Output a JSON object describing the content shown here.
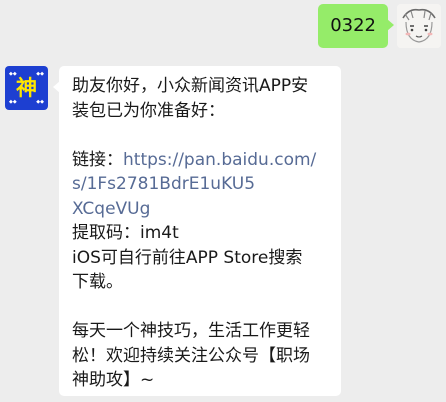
{
  "colors": {
    "background": "#ededed",
    "outgoing_bubble": "#95ec69",
    "incoming_bubble": "#ffffff",
    "link": "#576b95",
    "bot_avatar_bg": "#1d3fd1",
    "bot_avatar_text": "#ffe600"
  },
  "outgoing": {
    "text": "0322",
    "avatar_icon": "user-avatar-icon"
  },
  "incoming": {
    "avatar": {
      "char": "神",
      "icon": "shen-logo-icon"
    },
    "lines": {
      "greeting_1": "助友你好，小众新闻资讯APP安",
      "greeting_2": "装包已为你准备好：",
      "link_label": "链接：",
      "link_1": "https://pan.baidu.com/",
      "link_2": "s/1Fs2781BdrE1uKU5",
      "link_3": "XCqeVUg",
      "code": "提取码：im4t",
      "ios_1": "iOS可自行前往APP Store搜索",
      "ios_2": "下载。",
      "footer_1": "每天一个神技巧，生活工作更轻",
      "footer_2": "松！欢迎持续关注公众号【职场",
      "footer_3": "神助攻】~"
    }
  }
}
